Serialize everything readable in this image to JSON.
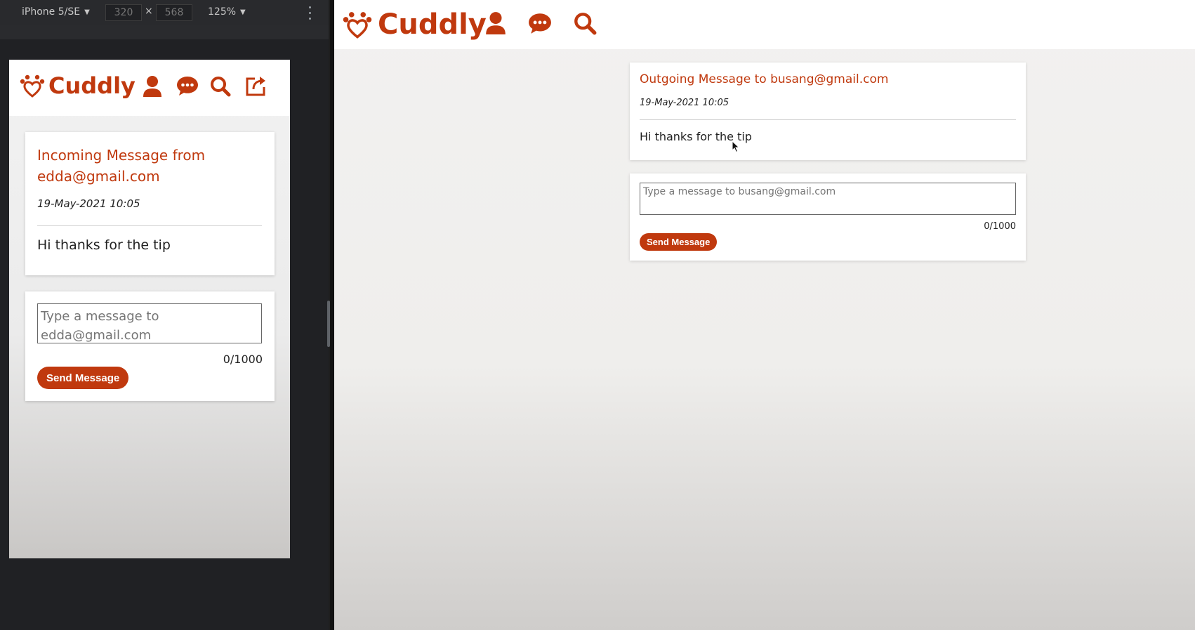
{
  "devtools": {
    "device": "iPhone 5/SE",
    "width": "320",
    "height": "568",
    "zoom": "125%"
  },
  "app": {
    "name": "Cuddly",
    "brand_color": "#c0390e",
    "nav_icons": [
      "profile-icon",
      "messages-icon",
      "search-icon",
      "logout-icon"
    ]
  },
  "mobile": {
    "message": {
      "title": "Incoming Message from edda@gmail.com",
      "date": "19-May-2021 10:05",
      "body": "Hi thanks for the tip"
    },
    "reply": {
      "placeholder": "Type a message to edda@gmail.com",
      "count": "0/1000",
      "send_label": "Send Message"
    }
  },
  "desktop": {
    "message": {
      "title": "Outgoing Message to busang@gmail.com",
      "date": "19-May-2021 10:05",
      "body": "Hi thanks for the tip"
    },
    "reply": {
      "placeholder": "Type a message to busang@gmail.com",
      "count": "0/1000",
      "send_label": "Send Message"
    }
  }
}
